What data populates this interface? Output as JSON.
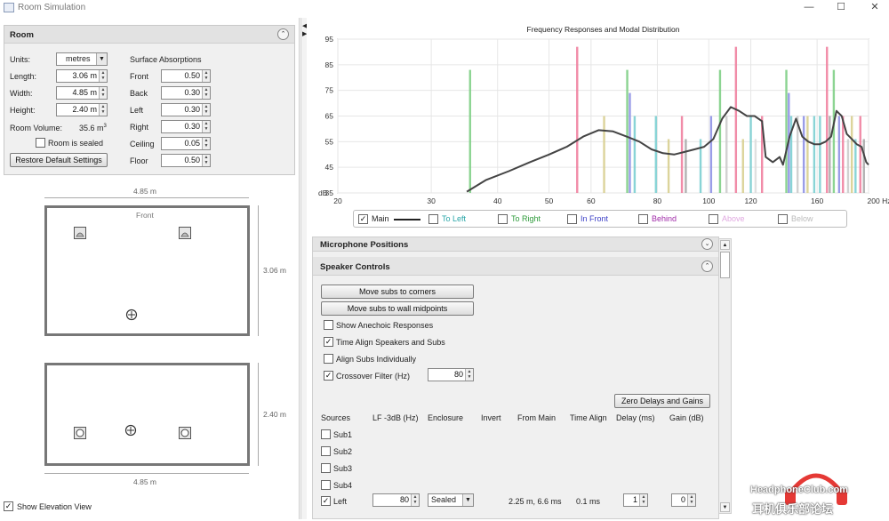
{
  "window": {
    "title": "Room Simulation"
  },
  "room": {
    "header": "Room",
    "units_label": "Units:",
    "units_value": "metres",
    "length_label": "Length:",
    "length_value": "3.06 m",
    "width_label": "Width:",
    "width_value": "4.85 m",
    "height_label": "Height:",
    "height_value": "2.40 m",
    "volume_label": "Room Volume:",
    "volume_value": "35.6 m",
    "volume_sup": "3",
    "sealed_label": "Room is sealed",
    "restore_label": "Restore Default Settings",
    "absorption_header": "Surface Absorptions",
    "surfaces": [
      {
        "label": "Front",
        "value": "0.50"
      },
      {
        "label": "Back",
        "value": "0.30"
      },
      {
        "label": "Left",
        "value": "0.30"
      },
      {
        "label": "Right",
        "value": "0.30"
      },
      {
        "label": "Ceiling",
        "value": "0.05"
      },
      {
        "label": "Floor",
        "value": "0.50"
      }
    ]
  },
  "plan": {
    "width_dim": "4.85 m",
    "front_label": "Front",
    "length_dim": "3.06 m",
    "elev_height_dim": "2.40 m",
    "elev_width_dim": "4.85 m",
    "show_elevation_label": "Show Elevation View",
    "show_elevation_checked": "✓"
  },
  "chart_data": {
    "type": "line",
    "title": "Frequency Responses and Modal Distribution",
    "ylabel": "dB",
    "xlabel": "",
    "x_scale": "log",
    "xlim": [
      20,
      200
    ],
    "ylim": [
      35,
      95
    ],
    "x_ticks": [
      "20",
      "30",
      "40",
      "50",
      "60",
      "80",
      "100",
      "120",
      "160",
      "200 Hz"
    ],
    "x_tick_values": [
      20,
      30,
      40,
      50,
      60,
      80,
      100,
      120,
      160,
      200
    ],
    "y_ticks": [
      "35",
      "45",
      "55",
      "65",
      "75",
      "85",
      "95"
    ],
    "y_tick_values": [
      35,
      45,
      55,
      65,
      75,
      85,
      95
    ],
    "grid": true,
    "series": [
      {
        "name": "Main",
        "color": "#444444",
        "x": [
          35,
          38,
          42,
          46,
          50,
          54,
          58,
          62,
          66,
          70,
          74,
          78,
          82,
          86,
          90,
          94,
          98,
          102,
          106,
          110,
          114,
          118,
          122,
          126,
          128,
          132,
          136,
          138,
          142,
          146,
          150,
          154,
          158,
          162,
          166,
          170,
          174,
          178,
          182,
          186,
          190,
          194,
          198,
          200
        ],
        "y": [
          35.5,
          40,
          43.5,
          47,
          50,
          53,
          57,
          59.5,
          59,
          57,
          55,
          52,
          50.5,
          50,
          51,
          52,
          53,
          56,
          64,
          68.5,
          67,
          65,
          65,
          63,
          49,
          47,
          49,
          46,
          57,
          64,
          57,
          55,
          54,
          54,
          55,
          57,
          67,
          65,
          58,
          56,
          54,
          53,
          47,
          46
        ]
      }
    ],
    "modes": [
      {
        "x": 35.5,
        "y": 83,
        "color": "#7fcf86"
      },
      {
        "x": 56.5,
        "y": 92,
        "color": "#ef7f9e"
      },
      {
        "x": 63.5,
        "y": 65,
        "color": "#d8cf90"
      },
      {
        "x": 70.2,
        "y": 83,
        "color": "#7fcf86"
      },
      {
        "x": 71,
        "y": 74,
        "color": "#8f92e6"
      },
      {
        "x": 72.5,
        "y": 65,
        "color": "#7ccfd2"
      },
      {
        "x": 79.5,
        "y": 65,
        "color": "#7ccfd2"
      },
      {
        "x": 84,
        "y": 56,
        "color": "#d8cf90"
      },
      {
        "x": 89,
        "y": 65,
        "color": "#ef7f9e"
      },
      {
        "x": 90.5,
        "y": 56,
        "color": "#aaaaaa"
      },
      {
        "x": 96.5,
        "y": 56,
        "color": "#7ccfd2"
      },
      {
        "x": 101,
        "y": 65,
        "color": "#8f92e6"
      },
      {
        "x": 105,
        "y": 83,
        "color": "#7fcf86"
      },
      {
        "x": 108,
        "y": 65,
        "color": "#cccccc"
      },
      {
        "x": 112.5,
        "y": 92,
        "color": "#ef7f9e"
      },
      {
        "x": 116,
        "y": 56,
        "color": "#d8cf90"
      },
      {
        "x": 120,
        "y": 65,
        "color": "#7ccfd2"
      },
      {
        "x": 122.5,
        "y": 56,
        "color": "#dddddd"
      },
      {
        "x": 126,
        "y": 65,
        "color": "#ef7f9e"
      },
      {
        "x": 140,
        "y": 83,
        "color": "#7fcf86"
      },
      {
        "x": 141.5,
        "y": 74,
        "color": "#8f92e6"
      },
      {
        "x": 143,
        "y": 65,
        "color": "#7ccfd2"
      },
      {
        "x": 147,
        "y": 65,
        "color": "#cccccc"
      },
      {
        "x": 151,
        "y": 65,
        "color": "#8f92e6"
      },
      {
        "x": 153.5,
        "y": 65,
        "color": "#d8cf90"
      },
      {
        "x": 158,
        "y": 65,
        "color": "#7ccfd2"
      },
      {
        "x": 162,
        "y": 65,
        "color": "#7ccfd2"
      },
      {
        "x": 167,
        "y": 92,
        "color": "#ef7f9e"
      },
      {
        "x": 169,
        "y": 65,
        "color": "#aaaaaa"
      },
      {
        "x": 172,
        "y": 83,
        "color": "#7fcf86"
      },
      {
        "x": 176,
        "y": 65,
        "color": "#8f92e6"
      },
      {
        "x": 179,
        "y": 65,
        "color": "#ef7f9e"
      },
      {
        "x": 183,
        "y": 56,
        "color": "#cccccc"
      },
      {
        "x": 186,
        "y": 65,
        "color": "#d8cf90"
      },
      {
        "x": 189,
        "y": 56,
        "color": "#7ccfd2"
      },
      {
        "x": 193,
        "y": 65,
        "color": "#ef7f9e"
      },
      {
        "x": 196,
        "y": 56,
        "color": "#aaaaaa"
      }
    ]
  },
  "legend": [
    {
      "label": "Main",
      "checked": "✓",
      "color": "#222222",
      "swatch": true
    },
    {
      "label": "To Left",
      "checked": "",
      "color": "#2aa6a8"
    },
    {
      "label": "To Right",
      "checked": "",
      "color": "#2e9b3a"
    },
    {
      "label": "In Front",
      "checked": "",
      "color": "#3b3fc6"
    },
    {
      "label": "Behind",
      "checked": "",
      "color": "#a02aa8"
    },
    {
      "label": "Above",
      "checked": "",
      "color": "#e0a8e0"
    },
    {
      "label": "Below",
      "checked": "",
      "color": "#bbbbbb"
    }
  ],
  "controls": {
    "mic_header": "Microphone Positions",
    "speaker_header": "Speaker Controls",
    "move_corners": "Move subs to corners",
    "move_midpoints": "Move subs to wall midpoints",
    "show_anechoic": "Show Anechoic Responses",
    "show_anechoic_checked": "",
    "time_align": "Time Align Speakers and Subs",
    "time_align_checked": "✓",
    "align_subs": "Align Subs Individually",
    "align_subs_checked": "",
    "crossover": "Crossover Filter (Hz)",
    "crossover_checked": "✓",
    "crossover_value": "80",
    "zero_delays": "Zero Delays and Gains",
    "columns": [
      "Sources",
      "LF -3dB (Hz)",
      "Enclosure",
      "Invert",
      "From Main",
      "Time Align",
      "Delay (ms)",
      "Gain (dB)"
    ],
    "sources": [
      {
        "name": "Sub1",
        "checked": ""
      },
      {
        "name": "Sub2",
        "checked": ""
      },
      {
        "name": "Sub3",
        "checked": ""
      },
      {
        "name": "Sub4",
        "checked": ""
      }
    ],
    "left_row": {
      "name": "Left",
      "checked": "✓",
      "lf": "80",
      "enclosure": "Sealed",
      "from_main": "2.25 m, 6.6 ms",
      "time_align": "0.1 ms",
      "delay": "1",
      "gain": "0"
    }
  },
  "watermark": {
    "brand": "HeadphoneClub.com",
    "cn": "耳机俱乐部论坛"
  }
}
